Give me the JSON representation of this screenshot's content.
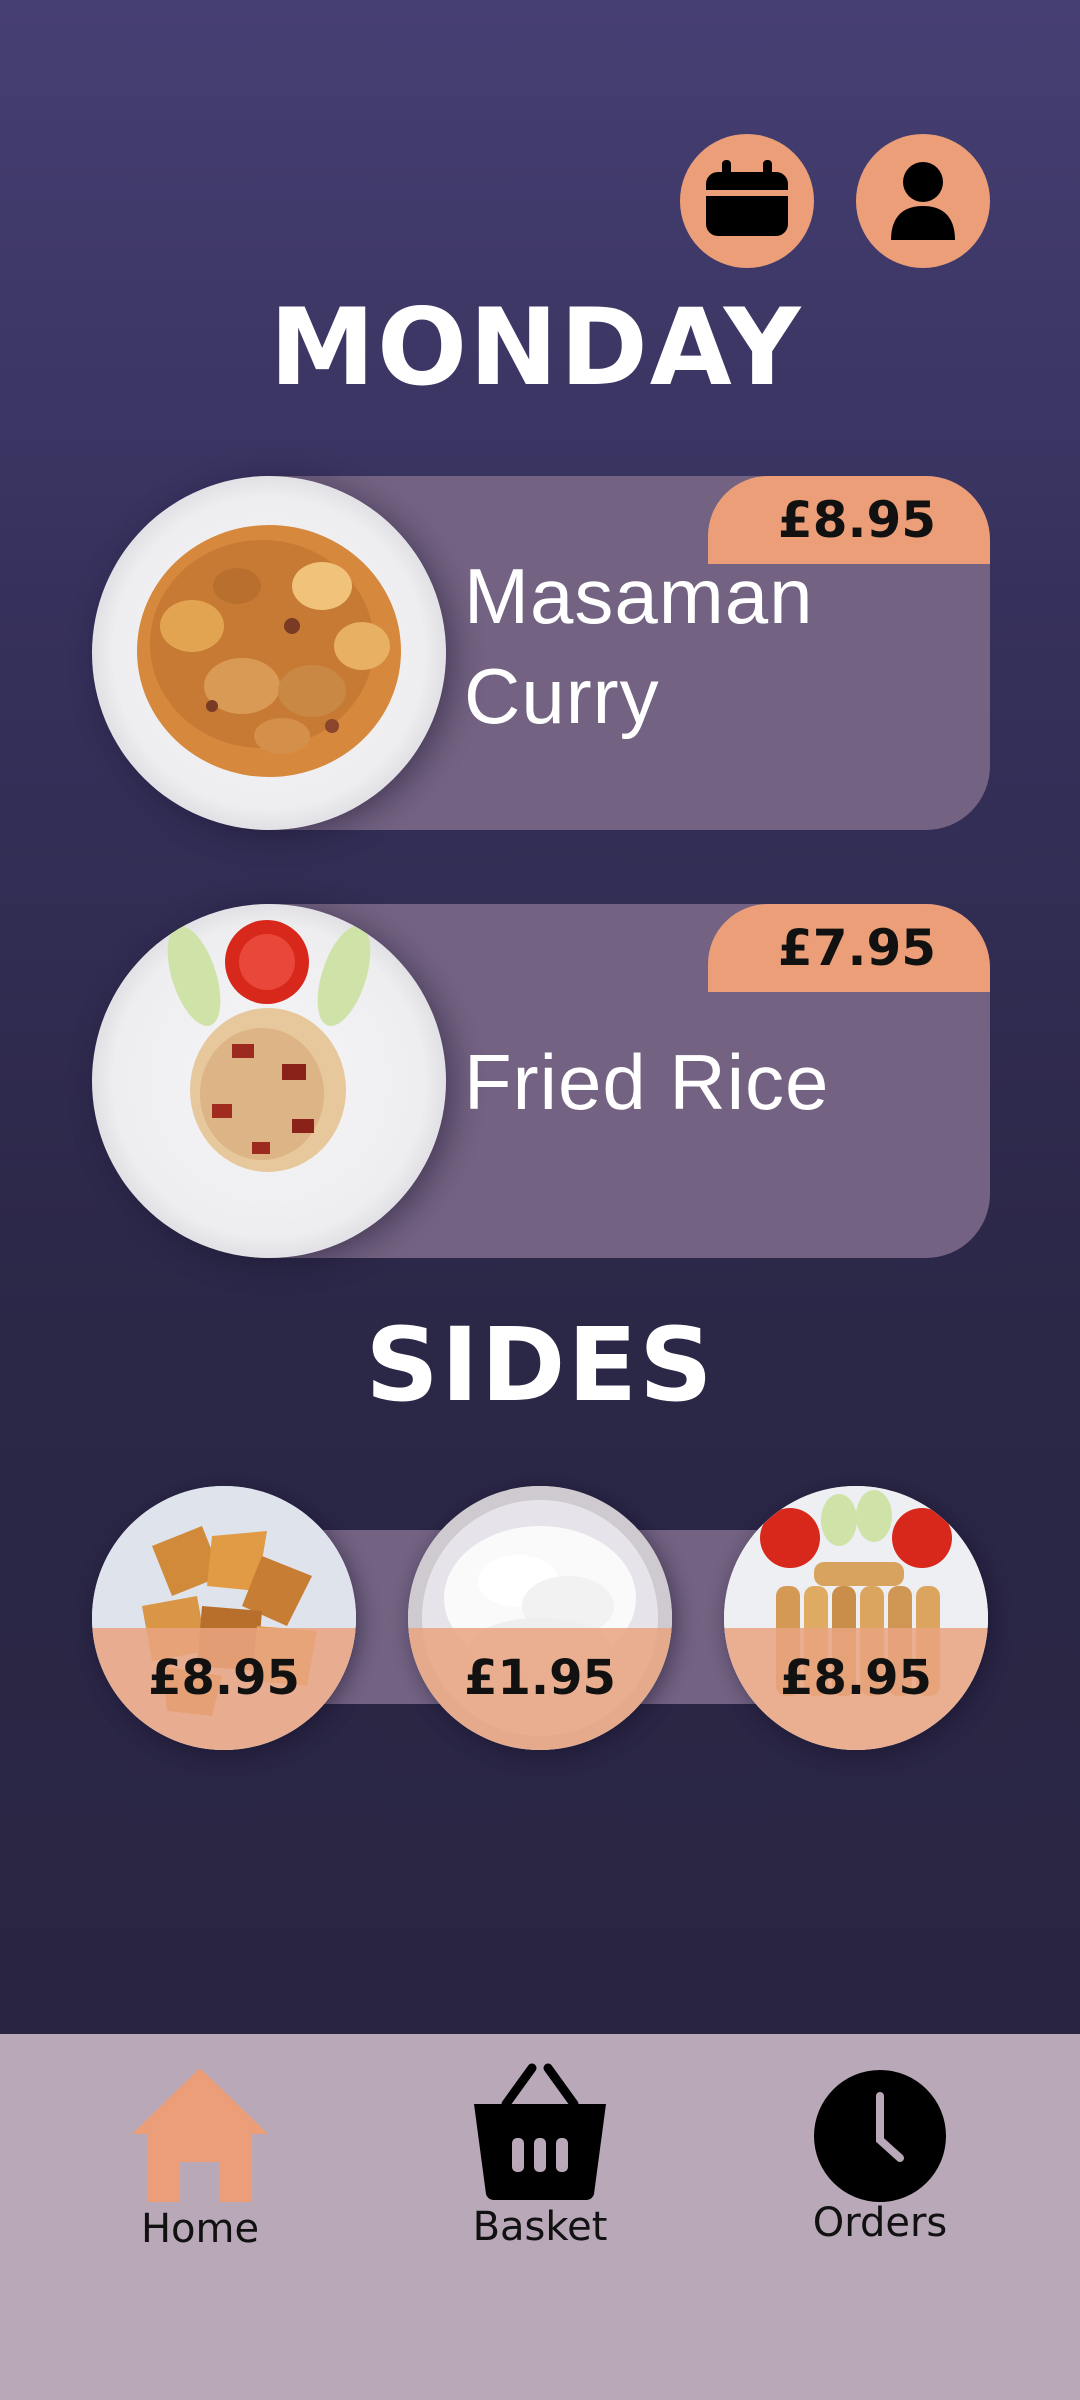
{
  "header": {
    "calendar_icon": "calendar-icon",
    "profile_icon": "user-icon"
  },
  "day_title": "MONDAY",
  "dishes": [
    {
      "name": "Masaman Curry",
      "name_line1": "Masaman",
      "name_line2": "Curry",
      "price": "£8.95"
    },
    {
      "name": "Fried Rice",
      "price": "£7.95"
    }
  ],
  "sides_title": "SIDES",
  "sides": [
    {
      "price": "£8.95"
    },
    {
      "price": "£1.95"
    },
    {
      "price": "£8.95"
    }
  ],
  "nav": {
    "home": {
      "label": "Home",
      "icon": "home-icon",
      "active": true
    },
    "basket": {
      "label": "Basket",
      "icon": "basket-icon"
    },
    "orders": {
      "label": "Orders",
      "icon": "clock-icon"
    }
  },
  "colors": {
    "accent": "#eb9e78",
    "card": "#736282",
    "background_top": "#463f73",
    "background_bottom": "#27233f",
    "nav_background": "#b8a8b8"
  }
}
